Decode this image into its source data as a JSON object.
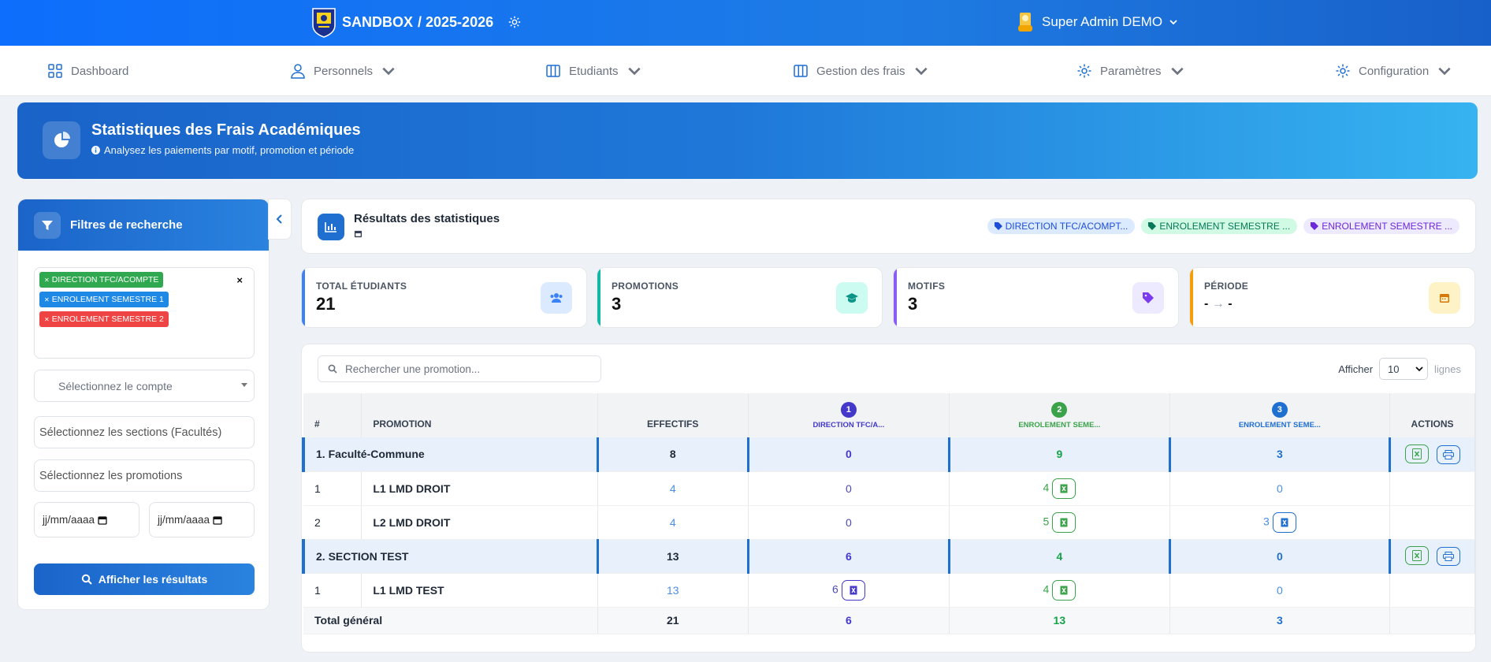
{
  "header": {
    "brand": "SANDBOX",
    "year": "/ 2025-2026",
    "user": "Super Admin DEMO"
  },
  "nav": {
    "dashboard": "Dashboard",
    "personnels": "Personnels",
    "etudiants": "Etudiants",
    "frais": "Gestion des frais",
    "parametres": "Paramètres",
    "configuration": "Configuration"
  },
  "banner": {
    "title": "Statistiques des Frais Académiques",
    "subtitle": "Analysez les paiements par motif, promotion et période"
  },
  "filters": {
    "title": "Filtres de recherche",
    "tags": [
      {
        "label": "DIRECTION TFC/ACOMPTE",
        "color": "#2fa84f"
      },
      {
        "label": "ENROLEMENT SEMESTRE 1",
        "color": "#1e88e5"
      },
      {
        "label": "ENROLEMENT SEMESTRE 2",
        "color": "#ef4444"
      }
    ],
    "account_placeholder": "Sélectionnez le compte",
    "sections_placeholder": "Sélectionnez les sections (Facultés)",
    "promotions_placeholder": "Sélectionnez les promotions",
    "date_placeholder": "jj/mm/aaaa",
    "submit": "Afficher les résultats"
  },
  "results": {
    "title": "Résultats des statistiques",
    "tags": [
      {
        "label": "DIRECTION TFC/ACOMPT...",
        "bg": "#dbeafe",
        "fg": "#1d4ed8"
      },
      {
        "label": "ENROLEMENT SEMESTRE ...",
        "bg": "#d1fae5",
        "fg": "#047857"
      },
      {
        "label": "ENROLEMENT SEMESTRE ...",
        "bg": "#ede9fe",
        "fg": "#6d28d9"
      }
    ]
  },
  "stats": {
    "students_label": "TOTAL ÉTUDIANTS",
    "students_value": "21",
    "promotions_label": "PROMOTIONS",
    "promotions_value": "3",
    "motifs_label": "MOTIFS",
    "motifs_value": "3",
    "period_label": "PÉRIODE",
    "period_from": "-",
    "period_arrow": "→",
    "period_to": "-"
  },
  "table": {
    "search_placeholder": "Rechercher une promotion...",
    "show_label": "Afficher",
    "show_value": "10",
    "show_suffix": "lignes",
    "headers": {
      "num": "#",
      "promotion": "PROMOTION",
      "effectifs": "EFFECTIFS",
      "m1_num": "1",
      "m1": "DIRECTION TFC/A...",
      "m2_num": "2",
      "m2": "ENROLEMENT SEME...",
      "m3_num": "3",
      "m3": "ENROLEMENT SEME...",
      "actions": "ACTIONS"
    },
    "g1": {
      "name": "1. Faculté-Commune",
      "eff": "8",
      "m1": "0",
      "m2": "9",
      "m3": "3"
    },
    "r1": {
      "num": "1",
      "name": "L1 LMD DROIT",
      "eff": "4",
      "m1": "0",
      "m2": "4",
      "m3": "0"
    },
    "r2": {
      "num": "2",
      "name": "L2 LMD DROIT",
      "eff": "4",
      "m1": "0",
      "m2": "5",
      "m3": "3"
    },
    "g2": {
      "name": "2. SECTION TEST",
      "eff": "13",
      "m1": "6",
      "m2": "4",
      "m3": "0"
    },
    "r3": {
      "num": "1",
      "name": "L1 LMD TEST",
      "eff": "13",
      "m1": "6",
      "m2": "4",
      "m3": "0"
    },
    "total": {
      "label": "Total général",
      "eff": "21",
      "m1": "6",
      "m2": "13",
      "m3": "3"
    }
  }
}
